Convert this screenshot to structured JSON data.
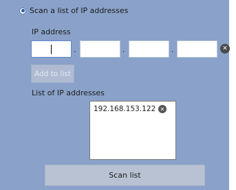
{
  "mode": {
    "radio_label": "Scan a list of IP addresses",
    "selected": true
  },
  "ip_entry": {
    "label": "IP address",
    "octets": [
      "",
      "",
      "",
      ""
    ],
    "separator": ".",
    "clear_icon": "close-circle-icon"
  },
  "add_button": {
    "label": "Add to list",
    "enabled": false
  },
  "ip_list": {
    "label": "List of IP addresses",
    "items": [
      "192.168.153.122"
    ],
    "remove_icon": "close-circle-icon"
  },
  "scan_button": {
    "label": "Scan list"
  },
  "colors": {
    "panel_bg": "#8aa2c9",
    "button_bg": "#b8c2d3",
    "disabled_text": "#e3e8f0"
  }
}
